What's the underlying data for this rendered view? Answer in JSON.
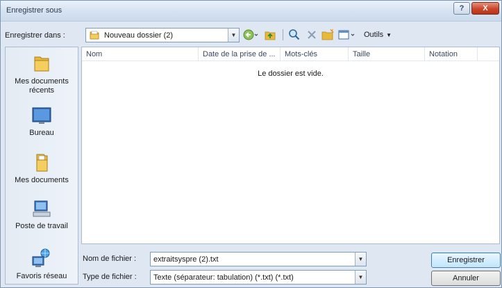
{
  "window": {
    "title": "Enregistrer sous",
    "help_label": "?",
    "close_label": "X"
  },
  "save_in": {
    "label": "Enregistrer dans :",
    "value": "Nouveau dossier (2)"
  },
  "toolbar": {
    "tools_label": "Outils"
  },
  "places": {
    "recent": "Mes documents récents",
    "desktop": "Bureau",
    "documents": "Mes documents",
    "computer": "Poste de travail",
    "network": "Favoris réseau"
  },
  "file_list": {
    "columns": [
      "Nom",
      "Date de la prise de ...",
      "Mots-clés",
      "Taille",
      "Notation"
    ],
    "empty_message": "Le dossier est vide."
  },
  "filename": {
    "label": "Nom de fichier :",
    "value": "extraitsyspre (2).txt"
  },
  "filetype": {
    "label": "Type de fichier :",
    "value": "Texte (séparateur: tabulation) (*.txt) (*.txt)"
  },
  "buttons": {
    "save": "Enregistrer",
    "cancel": "Annuler"
  },
  "colors": {
    "accent": "#3c7fb1",
    "close": "#c9462a",
    "folder": "#e8b93a"
  },
  "icons": [
    "help-icon",
    "close-icon",
    "folder-icon",
    "dropdown-arrow-icon",
    "back-icon",
    "up-folder-icon",
    "search-icon",
    "delete-icon",
    "new-folder-icon",
    "views-icon",
    "recent-documents-icon",
    "desktop-icon",
    "my-documents-icon",
    "computer-icon",
    "network-icon"
  ]
}
